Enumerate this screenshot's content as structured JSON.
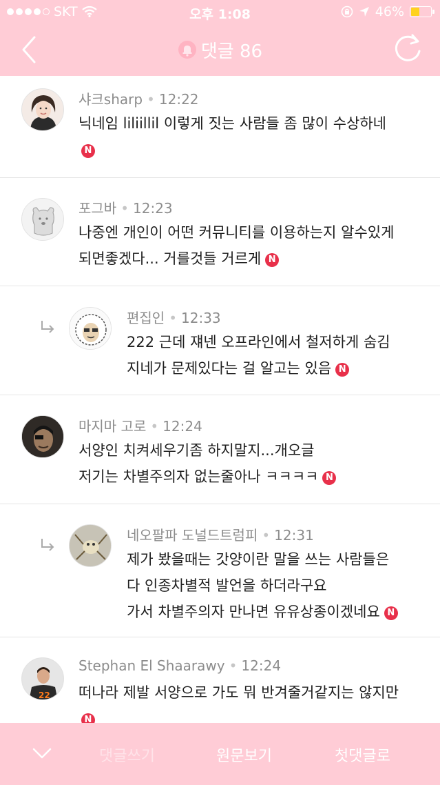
{
  "status_bar": {
    "carrier": "SKT",
    "time": "오후 1:08",
    "battery_percent": "46%",
    "battery_level": 0.46
  },
  "nav": {
    "title": "댓글 86",
    "back_icon": "chevron-left-icon",
    "refresh_icon": "refresh-icon"
  },
  "comments": [
    {
      "author": "샤크sharp",
      "time": "12:22",
      "lines": [
        "닉네임 liliillil 이렇게 짓는 사람들 좀 많이 수상하네",
        ""
      ],
      "badge": "N",
      "reply": false
    },
    {
      "author": "포그바",
      "time": "12:23",
      "lines": [
        "나중엔 개인이 어떤 커뮤니티를 이용하는지 알수있게",
        "되면좋겠다... 거를것들 거르게"
      ],
      "badge": "N",
      "reply": false
    },
    {
      "author": "편집인",
      "time": "12:33",
      "lines": [
        "222 근데 쟤넨 오프라인에서 철저하게 숨김",
        "지네가 문제있다는 걸 알고는 있음"
      ],
      "badge": "N",
      "reply": true
    },
    {
      "author": "마지마 고로",
      "time": "12:24",
      "lines": [
        "서양인 치켜세우기좀 하지말지...개오글",
        "저기는 차별주의자 없는줄아나 ㅋㅋㅋㅋ"
      ],
      "badge": "N",
      "reply": false
    },
    {
      "author": "네오팔파 도널드트럼피",
      "time": "12:31",
      "lines": [
        "제가 봤을때는 갓양이란 말을 쓰는 사람들은",
        "다 인종차별적 발언을 하더라구요",
        "가서 차별주의자 만나면 유유상종이겠네요"
      ],
      "badge": "N",
      "reply": true
    },
    {
      "author": "Stephan El Shaarawy",
      "time": "12:24",
      "lines": [
        "떠나라 제발 서양으로 가도 뭐 반겨줄거같지는 않지만",
        ""
      ],
      "badge": "N",
      "reply": false
    }
  ],
  "bottom_bar": {
    "write_comment": "댓글쓰기",
    "view_original": "원문보기",
    "first_comment": "첫댓글로"
  },
  "colors": {
    "bar_pink": "#ffccd6",
    "badge_red": "#e8304a",
    "meta_gray": "#8c8c8c"
  }
}
